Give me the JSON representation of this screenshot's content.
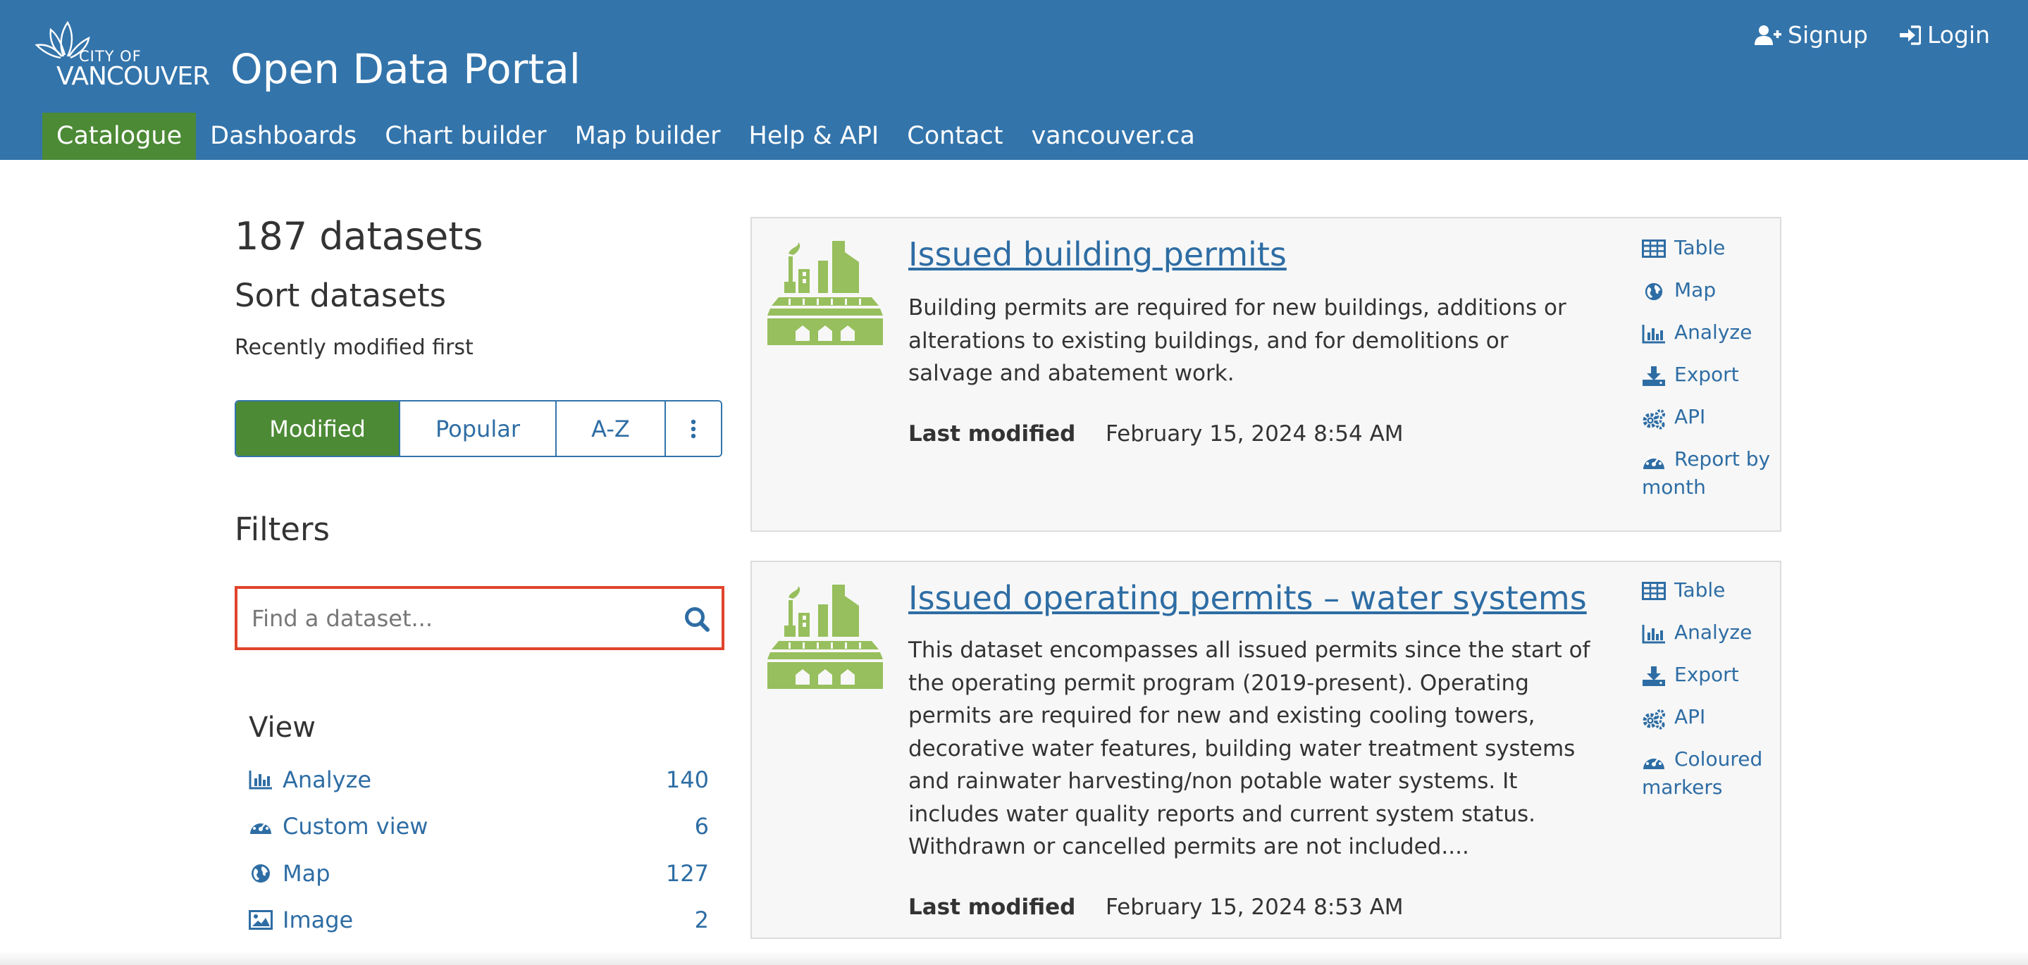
{
  "brand": {
    "logo_line1": "CITY OF",
    "logo_line2": "VANCOUVER",
    "portal_title": "Open Data Portal",
    "header_color": "#3374ab",
    "active_color": "#4c8a35"
  },
  "auth": {
    "signup": "Signup",
    "login": "Login"
  },
  "nav": [
    {
      "label": "Catalogue",
      "active": true
    },
    {
      "label": "Dashboards",
      "active": false
    },
    {
      "label": "Chart builder",
      "active": false
    },
    {
      "label": "Map builder",
      "active": false
    },
    {
      "label": "Help & API",
      "active": false
    },
    {
      "label": "Contact",
      "active": false
    },
    {
      "label": "vancouver.ca",
      "active": false
    }
  ],
  "sidebar": {
    "count": "187 datasets",
    "sort_heading": "Sort datasets",
    "sort_description": "Recently modified first",
    "sort_buttons": [
      {
        "label": "Modified",
        "active": true
      },
      {
        "label": "Popular",
        "active": false
      },
      {
        "label": "A-Z",
        "active": false
      },
      {
        "label": "⋮",
        "icon": "more-vertical-icon",
        "active": false
      }
    ],
    "filters_heading": "Filters",
    "search": {
      "placeholder": "Find a dataset...",
      "value": "",
      "icon": "search-icon",
      "highlight_color": "#e0442b"
    },
    "view_heading": "View",
    "view_items": [
      {
        "label": "Analyze",
        "count": "140",
        "icon": "bar-chart-icon"
      },
      {
        "label": "Custom view",
        "count": "6",
        "icon": "dashboard-icon"
      },
      {
        "label": "Map",
        "count": "127",
        "icon": "globe-icon"
      },
      {
        "label": "Image",
        "count": "2",
        "icon": "image-icon"
      }
    ]
  },
  "datasets": [
    {
      "title": "Issued building permits",
      "description": "Building permits are required for new buildings, additions or alterations to existing buildings, and for demolitions or salvage and abatement work.",
      "last_modified_label": "Last modified",
      "last_modified": "February 15, 2024 8:54 AM",
      "icon": "city-buildings-icon",
      "actions": [
        {
          "label": "Table",
          "icon": "table-icon"
        },
        {
          "label": "Map",
          "icon": "globe-icon"
        },
        {
          "label": "Analyze",
          "icon": "bar-chart-icon"
        },
        {
          "label": "Export",
          "icon": "download-icon"
        },
        {
          "label": "API",
          "icon": "gears-icon"
        },
        {
          "label": "Report by month",
          "icon": "dashboard-icon"
        }
      ]
    },
    {
      "title": "Issued operating permits – water systems",
      "description": "This dataset encompasses all issued permits since the start of the operating permit program (2019-present). Operating permits are required for new and existing cooling towers, decorative water features, building water treatment systems and rainwater harvesting/non potable water systems. It includes water quality reports and current system status. Withdrawn or cancelled permits are not included....",
      "last_modified_label": "Last modified",
      "last_modified": "February 15, 2024 8:53 AM",
      "icon": "city-buildings-icon",
      "actions": [
        {
          "label": "Table",
          "icon": "table-icon"
        },
        {
          "label": "Analyze",
          "icon": "bar-chart-icon"
        },
        {
          "label": "Export",
          "icon": "download-icon"
        },
        {
          "label": "API",
          "icon": "gears-icon"
        },
        {
          "label": "Coloured markers",
          "icon": "dashboard-icon"
        }
      ]
    }
  ]
}
